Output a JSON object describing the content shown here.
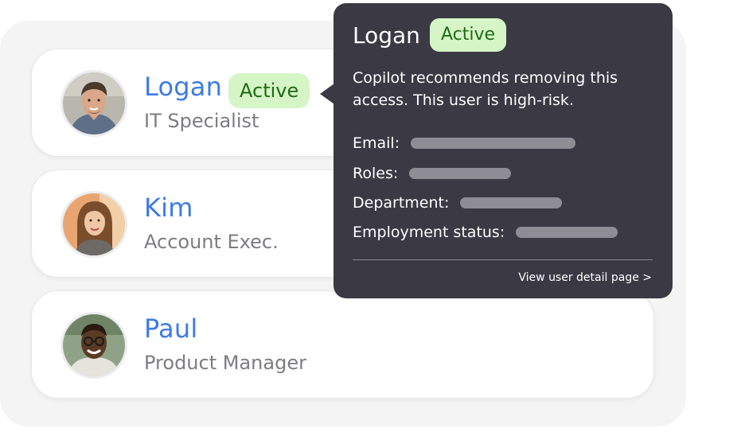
{
  "users": [
    {
      "name": "Logan",
      "role": "IT Specialist",
      "status": "Active"
    },
    {
      "name": "Kim",
      "role": "Account Exec."
    },
    {
      "name": "Paul",
      "role": "Product Manager"
    }
  ],
  "tooltip": {
    "name": "Logan",
    "status": "Active",
    "message": "Copilot recommends removing this access. This user is high-risk.",
    "fields": [
      {
        "label": "Email:"
      },
      {
        "label": "Roles:"
      },
      {
        "label": "Department:"
      },
      {
        "label": "Employment status:"
      }
    ],
    "link": "View user detail page >"
  },
  "colors": {
    "name_blue": "#3d7be6",
    "badge_bg": "#d5f5c7",
    "badge_text": "#1f6a14",
    "tooltip_bg": "#3b3944",
    "panel_bg": "#f4f4f5"
  },
  "icons": [
    "avatar-photo-logan",
    "avatar-photo-kim",
    "avatar-photo-paul",
    "chevron-right-icon"
  ]
}
